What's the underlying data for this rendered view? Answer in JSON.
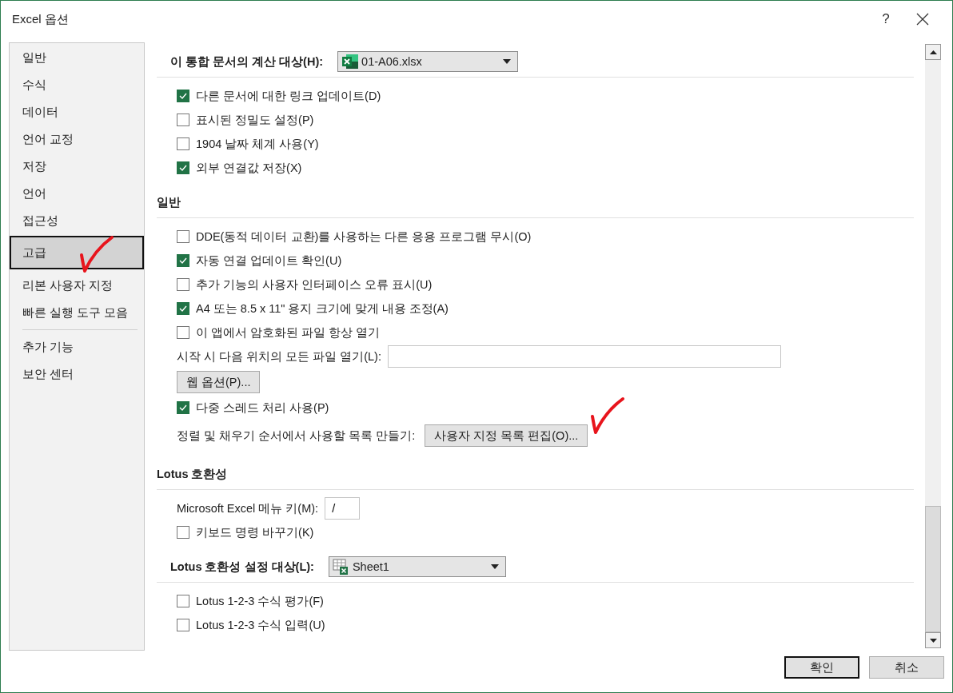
{
  "window": {
    "title": "Excel 옵션",
    "help": "?"
  },
  "sidebar": {
    "items": [
      {
        "label": "일반",
        "selected": false
      },
      {
        "label": "수식",
        "selected": false
      },
      {
        "label": "데이터",
        "selected": false
      },
      {
        "label": "언어 교정",
        "selected": false
      },
      {
        "label": "저장",
        "selected": false
      },
      {
        "label": "언어",
        "selected": false
      },
      {
        "label": "접근성",
        "selected": false
      },
      {
        "label": "고급",
        "selected": true
      },
      {
        "label": "리본 사용자 지정",
        "selected": false
      },
      {
        "label": "빠른 실행 도구 모음",
        "selected": false,
        "divider_after": true
      },
      {
        "label": "추가 기능",
        "selected": false
      },
      {
        "label": "보안 센터",
        "selected": false
      }
    ]
  },
  "sections": [
    {
      "heading": "이 통합 문서의 계산 대상(H):",
      "dropdown": {
        "value": "01-A06.xlsx",
        "kind": "workbook"
      },
      "items": [
        {
          "kind": "checkbox",
          "label": "다른 문서에 대한 링크 업데이트(D)",
          "checked": true
        },
        {
          "kind": "checkbox",
          "label": "표시된 정밀도 설정(P)",
          "checked": false
        },
        {
          "kind": "checkbox",
          "label": "1904 날짜 체계 사용(Y)",
          "checked": false
        },
        {
          "kind": "checkbox",
          "label": "외부 연결값 저장(X)",
          "checked": true
        }
      ]
    },
    {
      "heading": "일반",
      "items": [
        {
          "kind": "checkbox",
          "label": "DDE(동적 데이터 교환)를 사용하는 다른 응용 프로그램 무시(O)",
          "checked": false
        },
        {
          "kind": "checkbox",
          "label": "자동 연결 업데이트 확인(U)",
          "checked": true
        },
        {
          "kind": "checkbox",
          "label": "추가 기능의 사용자 인터페이스 오류 표시(U)",
          "checked": false
        },
        {
          "kind": "checkbox",
          "label": "A4 또는 8.5 x 11\" 용지 크기에 맞게 내용 조정(A)",
          "checked": true
        },
        {
          "kind": "checkbox",
          "label": "이 앱에서 암호화된 파일 항상 열기",
          "checked": false
        },
        {
          "kind": "field",
          "label": "시작 시 다음 위치의 모든 파일 열기(L):"
        },
        {
          "kind": "button",
          "label": "웹 옵션(P)..."
        },
        {
          "kind": "checkbox",
          "label": "다중 스레드 처리 사용(P)",
          "checked": true
        },
        {
          "kind": "label_button",
          "label": "정렬 및 채우기 순서에서 사용할 목록 만들기:",
          "button": "사용자 지정 목록 편집(O)...",
          "annotated": true
        }
      ]
    },
    {
      "heading": "Lotus 호환성",
      "items": [
        {
          "kind": "field",
          "label": "Microsoft Excel 메뉴 키(M):",
          "value": "/"
        },
        {
          "kind": "checkbox",
          "label": "키보드 명령 바꾸기(K)",
          "checked": false
        }
      ]
    },
    {
      "heading": "Lotus 호환성 설정 대상(L):",
      "dropdown": {
        "value": "Sheet1",
        "kind": "sheet"
      },
      "items": [
        {
          "kind": "checkbox",
          "label": "Lotus 1-2-3 수식 평가(F)",
          "checked": false
        },
        {
          "kind": "checkbox",
          "label": "Lotus 1-2-3 수식 입력(U)",
          "checked": false
        }
      ]
    }
  ],
  "buttons": [
    {
      "label": "확인",
      "default": true
    },
    {
      "label": "취소",
      "default": false
    }
  ]
}
